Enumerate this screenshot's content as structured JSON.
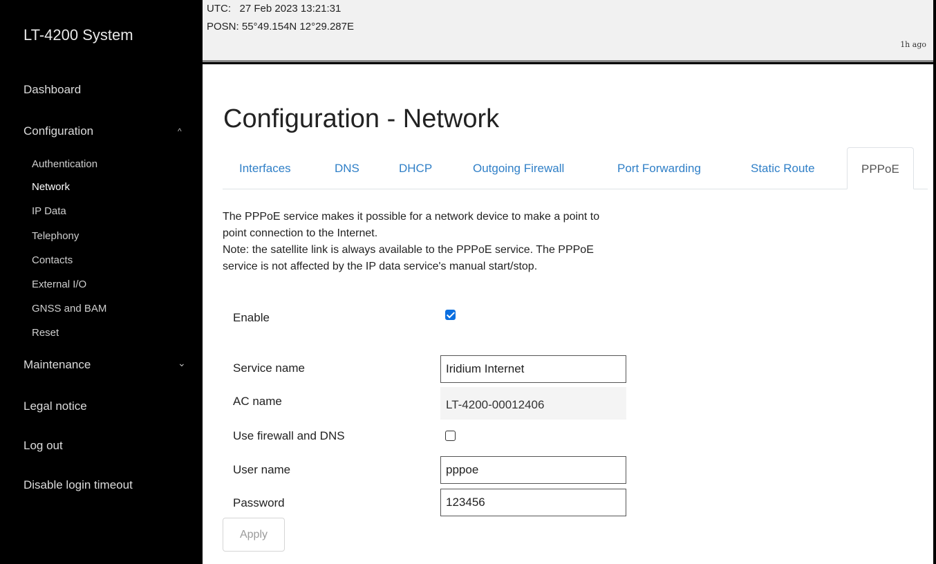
{
  "app": {
    "title": "LT-4200 System"
  },
  "sidebar": {
    "items": [
      {
        "label": "Dashboard"
      },
      {
        "label": "Configuration",
        "expanded": true
      },
      {
        "label": "Maintenance",
        "expanded": false
      },
      {
        "label": "Legal notice"
      },
      {
        "label": "Log out"
      },
      {
        "label": "Disable login timeout"
      }
    ],
    "config_sub": [
      "Authentication",
      "Network",
      "IP Data",
      "Telephony",
      "Contacts",
      "External I/O",
      "GNSS and BAM",
      "Reset"
    ],
    "active_sub": "Network",
    "chevron_up": "^",
    "chevron_down": "⌄"
  },
  "status": {
    "utc_label": "UTC:",
    "utc_value": "27 Feb 2023 13:21:31",
    "posn_label": "POSN:",
    "posn_value": "55°49.154N 12°29.287E",
    "age": "1h ago"
  },
  "page": {
    "title": "Configuration - Network"
  },
  "tabs": [
    {
      "label": "Interfaces"
    },
    {
      "label": "DNS"
    },
    {
      "label": "DHCP"
    },
    {
      "label": "Outgoing Firewall"
    },
    {
      "label": "Port Forwarding"
    },
    {
      "label": "Static Route"
    },
    {
      "label": "PPPoE",
      "active": true
    }
  ],
  "description": {
    "line1": "The PPPoE service makes it possible for a network device to make a point to",
    "line2": "point connection to the Internet.",
    "line3": "Note: the satellite link is always available to the PPPoE service. The PPPoE",
    "line4": "service is not affected by the IP data service's manual start/stop."
  },
  "form": {
    "enable_label": "Enable",
    "enable_checked": true,
    "service_name_label": "Service name",
    "service_name_value": "Iridium Internet",
    "ac_name_label": "AC name",
    "ac_name_value": "LT-4200-00012406",
    "firewall_label": "Use firewall and DNS",
    "firewall_checked": false,
    "user_label": "User name",
    "user_value": "pppoe",
    "password_label": "Password",
    "password_value": "123456",
    "apply_label": "Apply"
  },
  "colors": {
    "sidebar_bg": "#000000",
    "topbar_bg": "#f1f1f1",
    "link": "#2f7fc7",
    "checkbox_checked": "#0b6fe0"
  }
}
